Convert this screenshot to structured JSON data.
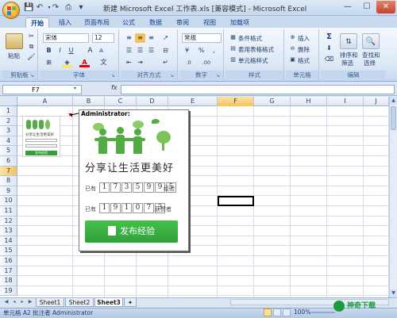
{
  "title_bar": {
    "title": "新建 Microsoft Excel 工作表.xls [兼容模式] - Microsoft Excel"
  },
  "ribbon_tabs": [
    "开始",
    "插入",
    "页面布局",
    "公式",
    "数据",
    "审阅",
    "视图",
    "加载项"
  ],
  "ribbon": {
    "clipboard": {
      "label": "剪贴板",
      "paste": "粘贴"
    },
    "font": {
      "label": "字体",
      "font_name": "宋体",
      "font_size": "12",
      "bold": "B",
      "italic": "I",
      "underline": "U",
      "grow": "A",
      "shrink": "A"
    },
    "alignment": {
      "label": "对齐方式"
    },
    "number": {
      "label": "数字",
      "format": "常规",
      "percent": "%",
      "comma": ",",
      "currency": "",
      "inc_dec": ".0",
      "dec_dec": ".00"
    },
    "styles": {
      "label": "样式",
      "conditional": "条件格式",
      "table": "套用表格格式",
      "cell": "单元格样式"
    },
    "cells": {
      "label": "单元格",
      "insert": "插入",
      "delete": "删除",
      "format": "格式"
    },
    "editing": {
      "label": "编辑",
      "sort": "排序和",
      "sort2": "筛选",
      "find": "查找和",
      "find2": "选择",
      "sigma": "Σ"
    }
  },
  "formula_bar": {
    "name_box": "F7",
    "fx": "fx",
    "value": ""
  },
  "columns": [
    "A",
    "B",
    "C",
    "D",
    "E",
    "F",
    "G",
    "H",
    "I",
    "J"
  ],
  "rows": [
    "1",
    "2",
    "3",
    "4",
    "5",
    "6",
    "7",
    "8",
    "9",
    "10",
    "11",
    "12",
    "13",
    "14",
    "15",
    "16",
    "17",
    "18",
    "19"
  ],
  "selected_column": "F",
  "selected_row": "7",
  "comment": {
    "author": "Administrator:",
    "slogan": "分享让生活更美好",
    "experience_label": "已有",
    "experience_digits": [
      "1",
      "7",
      "3",
      "5",
      "9",
      "9",
      "5"
    ],
    "experience_suffix": "经验",
    "readers_label": "已有",
    "readers_digits": [
      "1",
      "9",
      "1",
      "0",
      "7",
      "3"
    ],
    "readers_suffix": "获赞者",
    "button_label": "发布经验",
    "button_icon": "edit-icon"
  },
  "thumbnail": {
    "slogan": "分享让生活更美好",
    "button": "发布经验"
  },
  "sheets": [
    "Sheet1",
    "Sheet2",
    "Sheet3"
  ],
  "active_sheet": "Sheet3",
  "status_bar": {
    "text": "单元格 A2 批注者 Administrator",
    "zoom": "100%"
  },
  "watermark": "神奇下载",
  "colors": {
    "accent_green": "#53ab44",
    "button_green": "#2fa03a",
    "ribbon_blue": "#15428b"
  }
}
